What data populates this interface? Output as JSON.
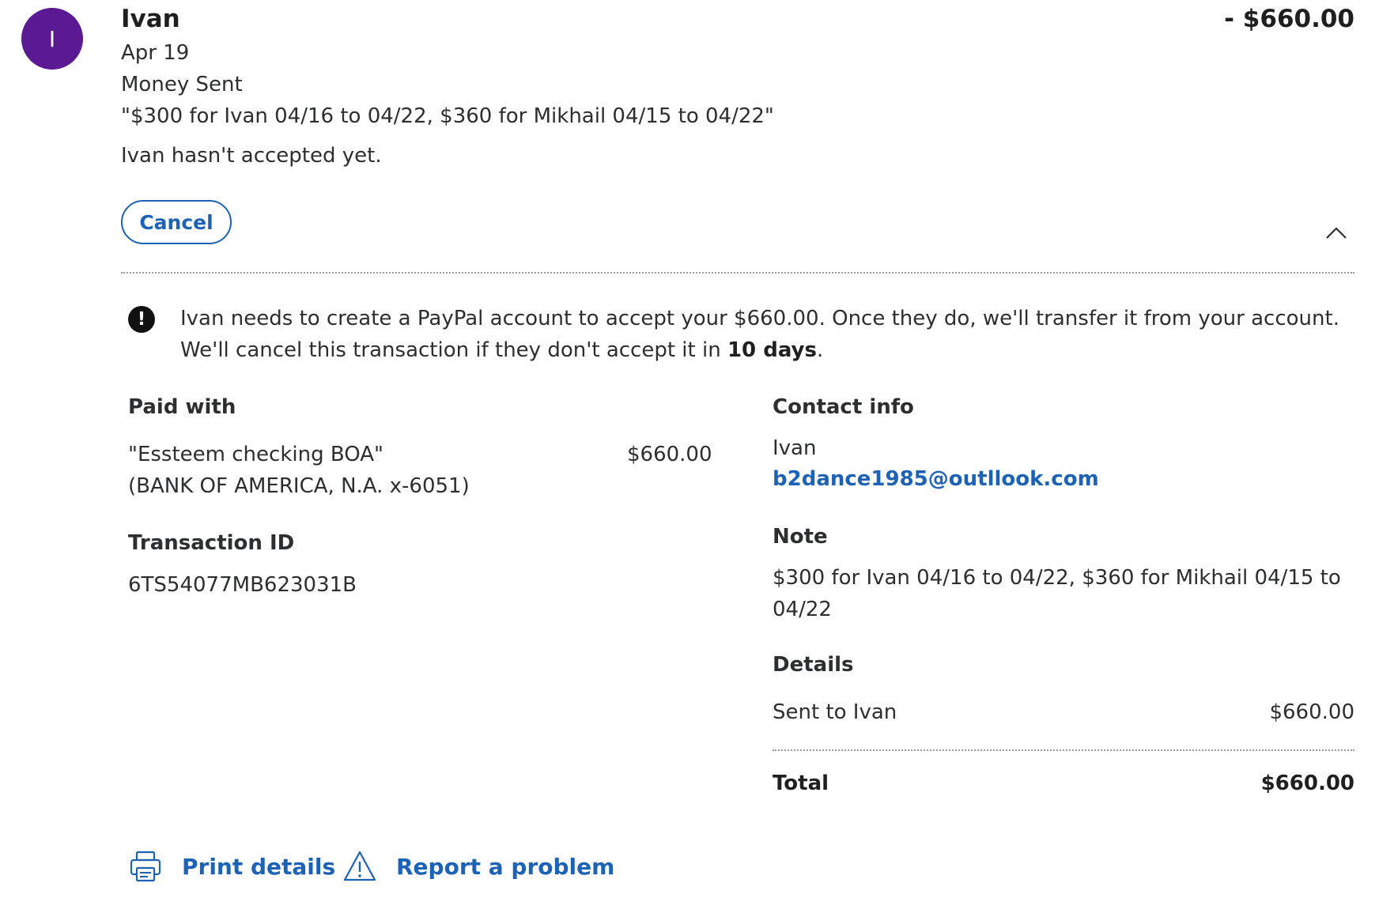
{
  "transaction": {
    "avatar_initial": "I",
    "name": "Ivan",
    "amount": "- $660.00",
    "date": "Apr 19",
    "type": "Money Sent",
    "note_quoted": "\"$300 for Ivan 04/16 to 04/22, $360 for Mikhail 04/15 to 04/22\"",
    "status": "Ivan hasn't accepted yet.",
    "cancel_label": "Cancel"
  },
  "alert": {
    "text_before": "Ivan needs to create a PayPal account to accept your $660.00. Once they do, we'll transfer it from your account. We'll cancel this transaction if they don't accept it in ",
    "text_bold": "10 days",
    "text_after": "."
  },
  "paid_with": {
    "heading": "Paid with",
    "account_name": "\"Essteem checking BOA\"",
    "bank": "(BANK OF AMERICA, N.A. x-6051)",
    "amount": "$660.00"
  },
  "transaction_id": {
    "heading": "Transaction ID",
    "value": "6TS54077MB623031B"
  },
  "contact": {
    "heading": "Contact info",
    "name": "Ivan",
    "email": "b2dance1985@outllook.com"
  },
  "note": {
    "heading": "Note",
    "line1": "$300 for Ivan 04/16 to 04/22, $360 for Mikhail 04/15 to",
    "line2": "04/22"
  },
  "details": {
    "heading": "Details",
    "rows": [
      {
        "label": "Sent to Ivan",
        "value": "$660.00"
      }
    ],
    "total_label": "Total",
    "total_value": "$660.00"
  },
  "actions": {
    "print_label": "Print details",
    "report_label": "Report a problem"
  },
  "colors": {
    "avatar": "#5b1a94",
    "link": "#1c63b8",
    "text": "#2c2e2f"
  }
}
